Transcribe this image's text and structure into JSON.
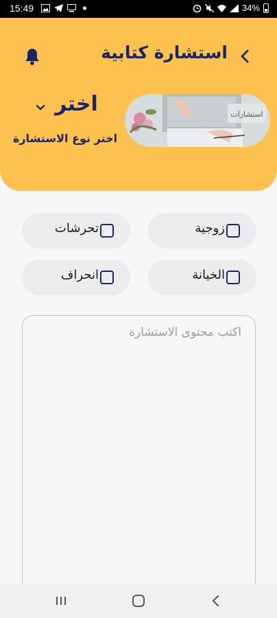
{
  "status_bar": {
    "time": "15:49",
    "battery": "34%",
    "left_icons": [
      "image-icon",
      "telegram-icon",
      "screen-icon",
      "dot-icon"
    ],
    "right_icons": [
      "alarm-icon",
      "mute-icon",
      "wifi-icon",
      "signal-icon",
      "battery-icon"
    ]
  },
  "header": {
    "title": "استشارة كتابية",
    "back_icon": "chevron-left-icon",
    "bell_icon": "bell-icon",
    "banner_text": "استشارات",
    "select_value": "اختر",
    "select_hint": "اختر نوع الاستشارة"
  },
  "options": [
    {
      "label": "زوجية",
      "checked": false
    },
    {
      "label": "تحرشات",
      "checked": false
    },
    {
      "label": "الخيانة",
      "checked": false
    },
    {
      "label": "انحراف",
      "checked": false
    }
  ],
  "content_input": {
    "placeholder": "اكتب محتوى الاستشارة",
    "value": ""
  },
  "nav_bar": {
    "buttons": [
      "recents-icon",
      "home-icon",
      "back-icon"
    ]
  },
  "colors": {
    "header_bg": "#fcc14e",
    "accent_navy": "#1a2466",
    "chip_bg": "#ececee",
    "page_bg": "#f7f7f9"
  }
}
